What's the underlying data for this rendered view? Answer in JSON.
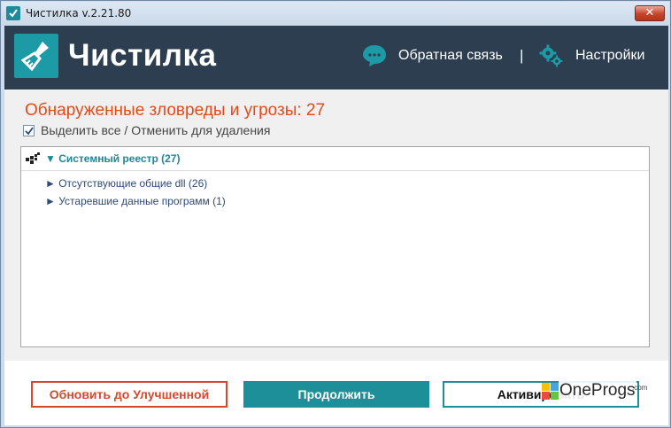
{
  "window": {
    "title": "Чистилка v.2.21.80",
    "close_label": "✕"
  },
  "header": {
    "app_name": "Чистилка",
    "feedback_label": "Обратная связь",
    "separator": "|",
    "settings_label": "Настройки",
    "bg_color": "#2c3e50",
    "accent_color": "#1c9aa6"
  },
  "main": {
    "threats_title": "Обнаруженные зловреды и угрозы: 27",
    "select_all_checked": true,
    "select_all_label": "Выделить все / Отменить для удаления",
    "tree": {
      "root_label": "▼ Системный реестр (27)",
      "children": [
        {
          "label": "► Отсутствующие общие dll (26)"
        },
        {
          "label": "► Устаревшие данные программ (1)"
        }
      ]
    }
  },
  "footer": {
    "upgrade_label": "Обновить до Улучшенной",
    "continue_label": "Продолжить",
    "activate_label": "Активировать",
    "upgrade_color": "#d9472b",
    "continue_color": "#1c8f99"
  },
  "watermark": {
    "text": "OneProgs",
    "suffix": ".com"
  }
}
